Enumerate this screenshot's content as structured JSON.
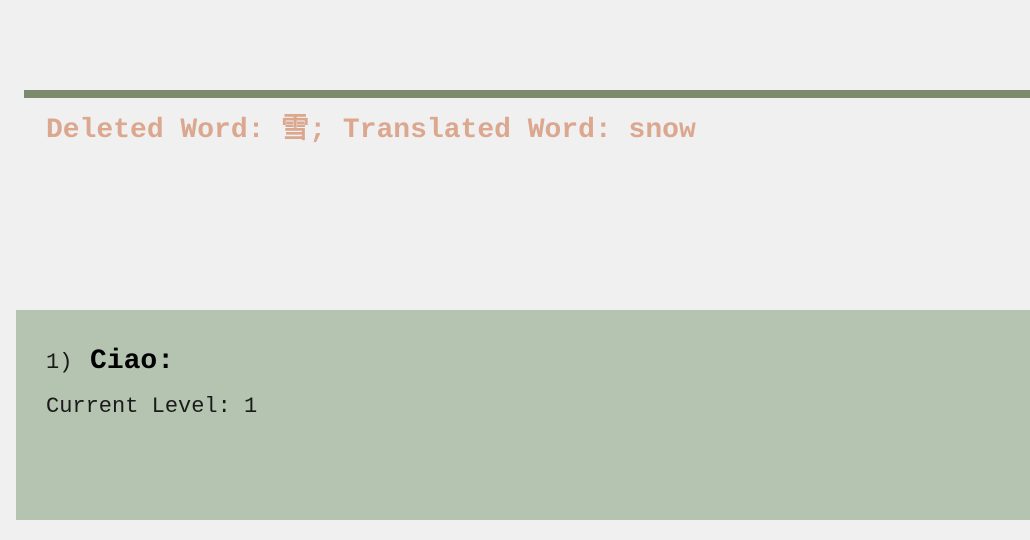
{
  "status": {
    "deleted_label": "Deleted Word:",
    "deleted_word": "雪",
    "separator": ";",
    "translated_label": "Translated Word:",
    "translated_word": "snow"
  },
  "words": [
    {
      "index": "1)",
      "word": "Ciao:",
      "level_label": "Current Level:",
      "level": "1"
    }
  ],
  "colors": {
    "background": "#f0f0f0",
    "divider": "#7b8c6e",
    "status_text": "#dba78f",
    "card_background": "#b4c4b1"
  }
}
